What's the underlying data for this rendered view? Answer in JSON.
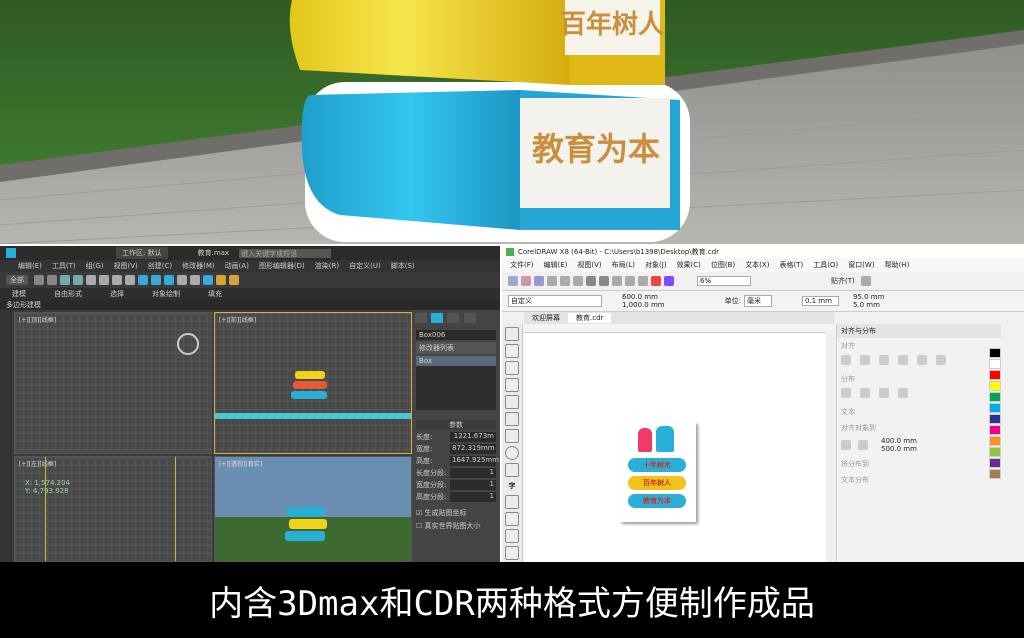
{
  "banner": {
    "text": "内含3Dmax和CDR两种格式方便制作成品"
  },
  "render": {
    "book_top_text": "百年树人",
    "book_bottom_text": "教育为本"
  },
  "max": {
    "title": "教育.max",
    "search_placeholder": "键入关键字或短语",
    "workspace": "工作区: 默认",
    "menu": [
      "编辑(E)",
      "工具(T)",
      "组(G)",
      "视图(V)",
      "创建(C)",
      "修改器(M)",
      "动画(A)",
      "图形编辑器(D)",
      "渲染(R)",
      "Civil View",
      "自定义(U)",
      "脚本(S)",
      "内容",
      "帮助(H)"
    ],
    "ribbon_tabs": [
      "建模",
      "自由形式",
      "选择",
      "对象绘制",
      "填充"
    ],
    "sub_label": "多边形建模",
    "all_label": "全部",
    "viewports": [
      "[+][顶][线框]",
      "[+][前][线框]",
      "[+][左][线框]",
      "[+][透视][真实]"
    ],
    "command_panel": {
      "object_name": "Box006",
      "modifier": "修改器列表",
      "stack_item": "Box",
      "section": "参数",
      "params": [
        {
          "label": "长度:",
          "value": "1221.673m"
        },
        {
          "label": "宽度:",
          "value": "872.319mm"
        },
        {
          "label": "高度:",
          "value": "1647.925mm"
        },
        {
          "label": "长度分段:",
          "value": "1"
        },
        {
          "label": "宽度分段:",
          "value": "1"
        },
        {
          "label": "高度分段:",
          "value": "1"
        }
      ],
      "check1": "生成贴图坐标",
      "check2": "真实世界贴图大小"
    },
    "coords": [
      "X: 1,574.204",
      "Y: 4,793.928"
    ]
  },
  "cdr": {
    "title": "CorelDRAW X8 (64-Bit) - C:\\Users\\b1398\\Desktop\\教育.cdr",
    "menu": [
      "文件(F)",
      "编辑(E)",
      "视图(V)",
      "布局(L)",
      "对象(J)",
      "效果(C)",
      "位图(B)",
      "文本(X)",
      "表格(T)",
      "工具(O)",
      "窗口(W)",
      "帮助(H)"
    ],
    "zoom": "6%",
    "snap": "贴齐(T)",
    "preset": "自定义",
    "width": "600.0 mm",
    "height": "1,000.0 mm",
    "units_label": "单位:",
    "units": "毫米",
    "nudge": "0.1 mm",
    "dup_x": "95.0 mm",
    "dup_y": "5.0 mm",
    "tabs": [
      "欢迎屏幕",
      "教育.cdr"
    ],
    "dock_title": "对齐与分布",
    "dock_sections": [
      "对齐",
      "分布",
      "文本",
      "对齐对象到",
      "将分布到",
      "文本分布"
    ],
    "dock_x": "400.0 mm",
    "dock_y": "500.0 mm",
    "sign": {
      "line1": "十年树木",
      "line2": "百年树人",
      "line3": "教育为本"
    },
    "palette": [
      "#000000",
      "#ffffff",
      "#ff0000",
      "#ffff00",
      "#00a651",
      "#00aeef",
      "#2e3192",
      "#ec008c",
      "#f7941d",
      "#8dc63f",
      "#662d91",
      "#a67c52"
    ]
  }
}
